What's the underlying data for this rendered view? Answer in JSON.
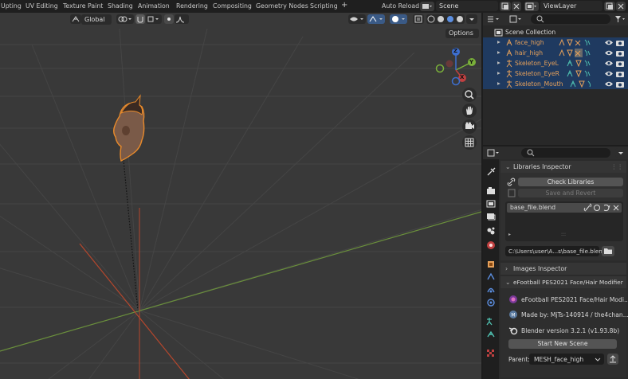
{
  "top_bar": {
    "workspace_tabs": [
      "Upting",
      "UV Editing",
      "Texture Paint",
      "Shading",
      "Animation",
      "Rendering",
      "Compositing",
      "Geometry Nodes",
      "Scripting"
    ],
    "add_tab": "+",
    "auto_reload": "Auto Reload",
    "scene_name": "Scene",
    "view_layer": "ViewLayer"
  },
  "viewport": {
    "transform_orientation": "Global",
    "options_label": "Options",
    "gizmo": {
      "x": "X",
      "y": "Y",
      "z": "Z"
    }
  },
  "outliner": {
    "collection": "Scene Collection",
    "items": [
      {
        "name": "face_high"
      },
      {
        "name": "hair_high"
      },
      {
        "name": "Skeleton_EyeL"
      },
      {
        "name": "Skeleton_EyeR"
      },
      {
        "name": "Skeleton_Mouth"
      }
    ]
  },
  "properties": {
    "libraries_panel": {
      "title": "Libraries Inspector",
      "check_button": "Check Libraries",
      "save_button": "Save and Revert",
      "list_item": "base_file.blend",
      "path": "C:\\Users\\user\\A...s\\base_file.blend"
    },
    "images_panel": {
      "title": "Images Inspector"
    },
    "modifier_panel": {
      "title": "eFootball PES2021 Face/Hair Modifier",
      "name_line": "eFootball PES2021 Face/Hair Modi...",
      "made_by": "Made by: MjTs-140914 / the4chan...",
      "version": "Blender version 3.2.1 (v1.93.8b)",
      "start_button": "Start New Scene",
      "parent_label": "Parent:",
      "parent_value": "MESH_face_high"
    }
  }
}
